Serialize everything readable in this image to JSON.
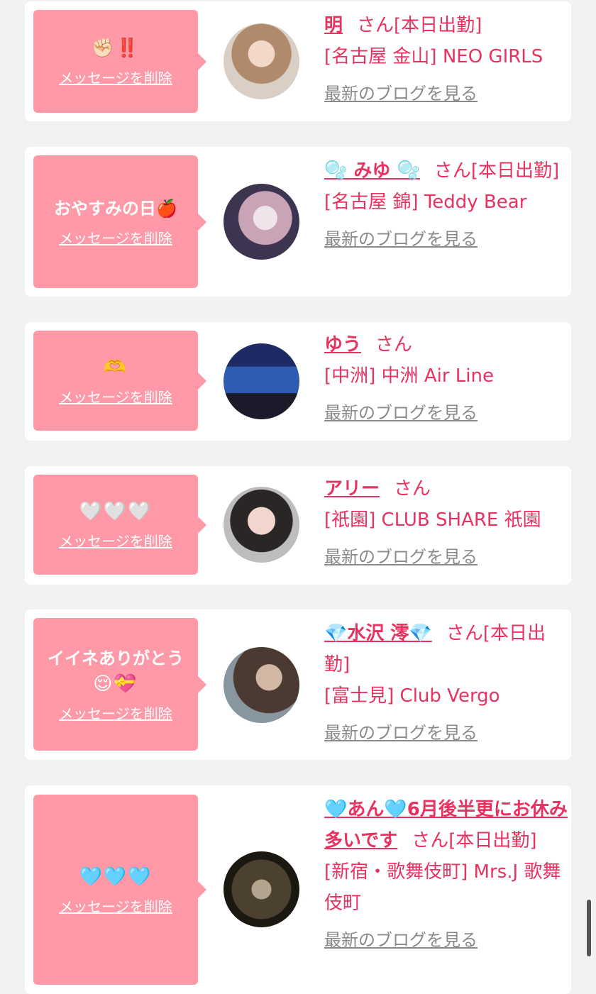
{
  "common": {
    "delete_label": "メッセージを削除",
    "blog_label": "最新のブログを見る",
    "san": "さん"
  },
  "colors": {
    "page_bg": "#f2f2f2",
    "bubble": "#ff99a8",
    "accent": "#e8325f",
    "link_gray": "#8a8a8a"
  },
  "items": [
    {
      "message": "",
      "message_emoji": "✊🏻‼️",
      "name": "明",
      "status": "[本日出勤]",
      "location": "[名古屋 金山] NEO GIRLS"
    },
    {
      "message": "おやすみの日",
      "message_emoji": "🍎",
      "name": "🫧 みゆ 🫧",
      "status": "[本日出勤]",
      "location": "[名古屋 錦] Teddy Bear"
    },
    {
      "message": "",
      "message_emoji": "🫶",
      "name": "ゆう",
      "status": "",
      "location": "[中洲] 中洲 Air Line"
    },
    {
      "message": "",
      "message_emoji": "🤍🤍🤍",
      "name": "アリー",
      "status": "",
      "location": "[祇園] CLUB SHARE 祇園"
    },
    {
      "message": "イイネありがとう",
      "message_emoji": "😌💝",
      "name": "💎水沢 澪💎",
      "status": "[本日出勤]",
      "location": "[富士見] Club Vergo"
    },
    {
      "message": "",
      "message_emoji": "🩵🩵🩵",
      "name": "🩵あん🩵6月後半更にお休み多いです",
      "status": "[本日出勤]",
      "location": "[新宿・歌舞伎町] Mrs.J 歌舞伎町"
    }
  ]
}
